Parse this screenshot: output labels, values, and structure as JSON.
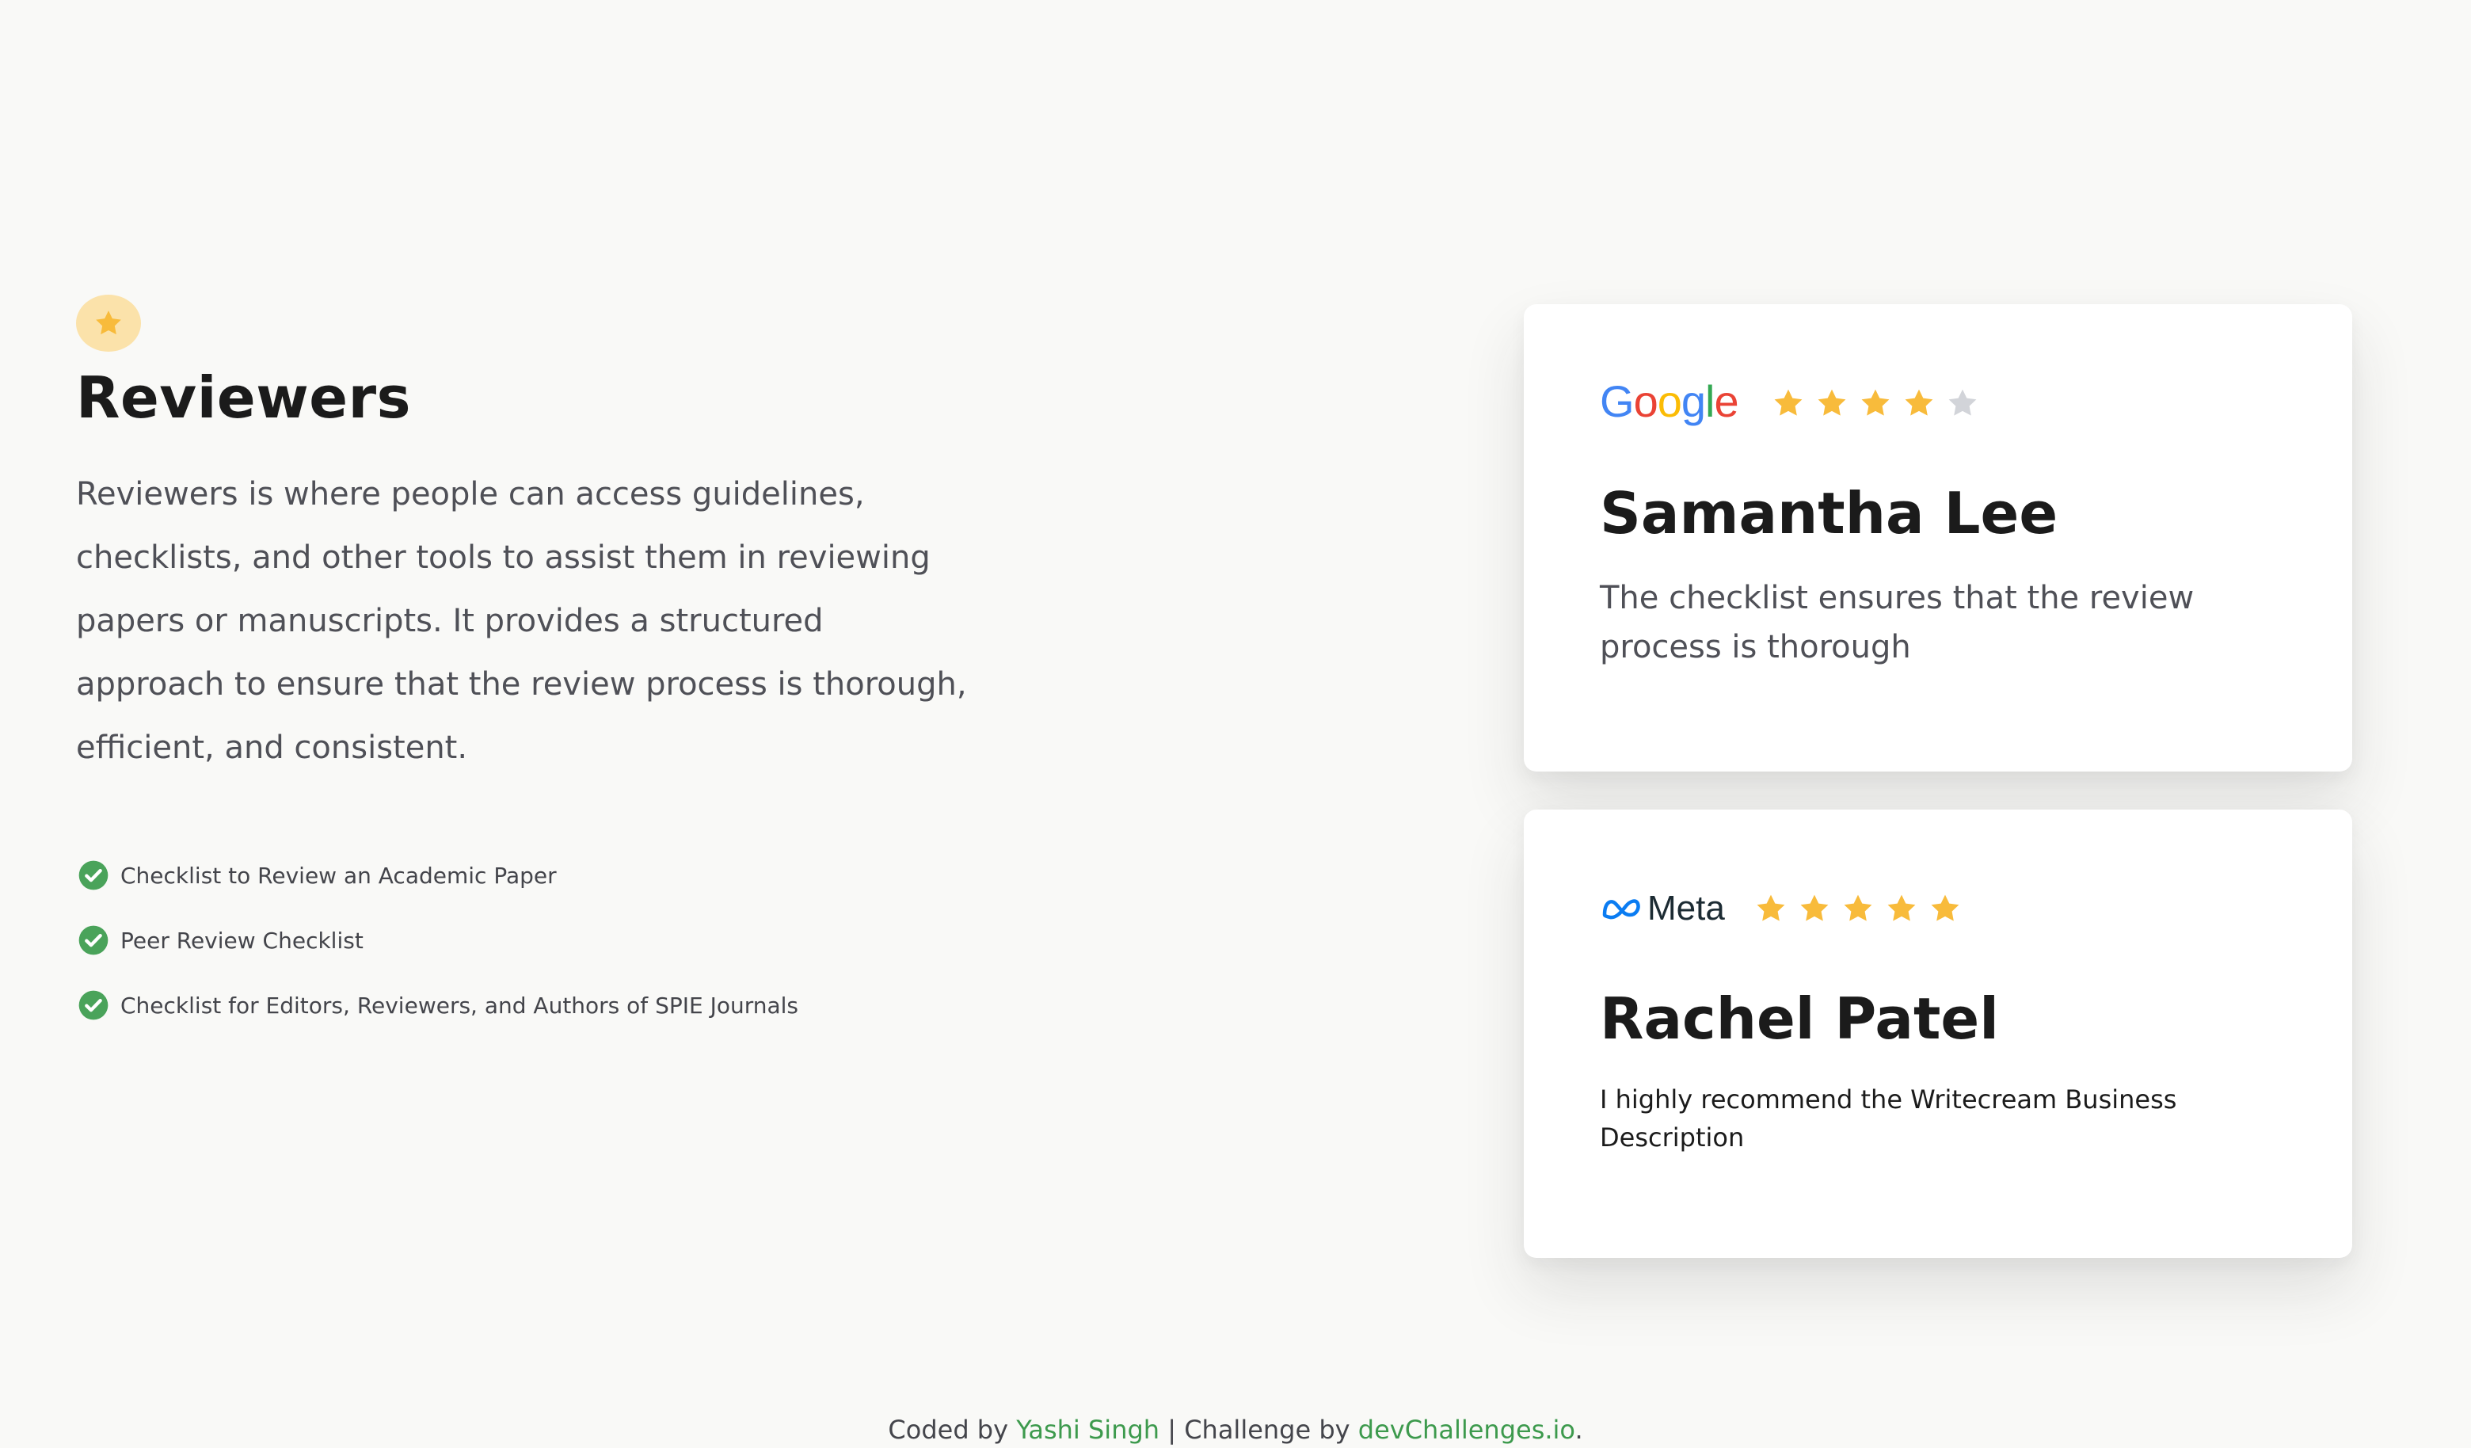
{
  "hero": {
    "title": "Reviewers",
    "description": "Reviewers is where people can access guidelines, checklists, and other tools to assist them in reviewing papers or manuscripts. It provides a structured approach to ensure that the review process is thorough, efficient, and consistent.",
    "badge_icon": "star-icon"
  },
  "checklist": [
    {
      "label": "Checklist to Review an Academic Paper",
      "icon": "check-circle-icon"
    },
    {
      "label": "Peer Review Checklist",
      "icon": "check-circle-icon"
    },
    {
      "label": "Checklist for Editors, Reviewers, and Authors of SPIE Journals",
      "icon": "check-circle-icon"
    }
  ],
  "reviews": [
    {
      "company": "Google",
      "rating": 4,
      "max_rating": 5,
      "name": "Samantha Lee",
      "quote": "The checklist ensures that the review process is thorough"
    },
    {
      "company": "Meta",
      "rating": 5,
      "max_rating": 5,
      "name": "Rachel Patel",
      "quote": "I highly recommend the Writecream Business Description"
    }
  ],
  "footer": {
    "prefix": "Coded by ",
    "author": "Yashi Singh",
    "separator": " | Challenge by ",
    "challenge": "devChallenges.io",
    "suffix": "."
  },
  "colors": {
    "background": "#f9f9f7",
    "star_filled": "#f8bb3b",
    "star_empty": "#d2d4d9",
    "check": "#4aa35a",
    "badge_bg": "#fbe2aa",
    "link": "#3d9a4d"
  }
}
